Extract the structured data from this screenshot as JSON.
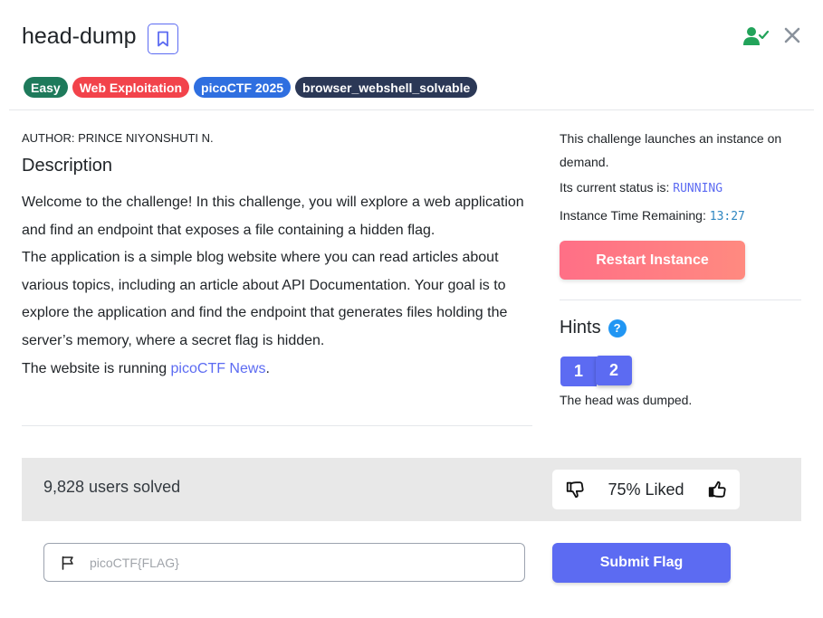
{
  "challenge": {
    "title": "head-dump",
    "author": "AUTHOR: PRINCE NIYONSHUTI N.",
    "tags": [
      {
        "label": "Easy",
        "color": "#1e7a5b"
      },
      {
        "label": "Web Exploitation",
        "color": "#f2434b"
      },
      {
        "label": "picoCTF 2025",
        "color": "#2f6fe0"
      },
      {
        "label": "browser_webshell_solvable",
        "color": "#2b3856"
      }
    ]
  },
  "header": {
    "bookmark_icon": "bookmark-icon",
    "user_icon": "user-check-icon",
    "close_icon": "close-icon",
    "user_icon_color": "#22a35a"
  },
  "description": {
    "heading": "Description",
    "p1": "Welcome to the challenge! In this challenge, you will explore a web application and find an endpoint that exposes a file containing a hidden flag.",
    "p2": "The application is a simple blog website where you can read articles about various topics, including an article about API Documentation. Your goal is to explore the application and find the endpoint that generates files holding the server’s memory, where a secret flag is hidden.",
    "p3_prefix": "The website is running ",
    "p3_link": "picoCTF News",
    "p3_suffix": "."
  },
  "instance": {
    "launch_text": "This challenge launches an instance on demand.",
    "status_label": "Its current status is: ",
    "status_value": "RUNNING",
    "time_label": "Instance Time Remaining: ",
    "time_value": "13:27",
    "restart_label": "Restart Instance"
  },
  "hints": {
    "heading": "Hints",
    "help_icon": "?",
    "buttons": [
      "1",
      "2"
    ],
    "text": "The head was dumped."
  },
  "stats": {
    "solved": "9,828 users solved",
    "liked": "75% Liked"
  },
  "flag": {
    "placeholder": "picoCTF{FLAG}",
    "submit_label": "Submit Flag"
  },
  "colors": {
    "accent": "#5c6bf2",
    "restart": "#ff7385"
  }
}
